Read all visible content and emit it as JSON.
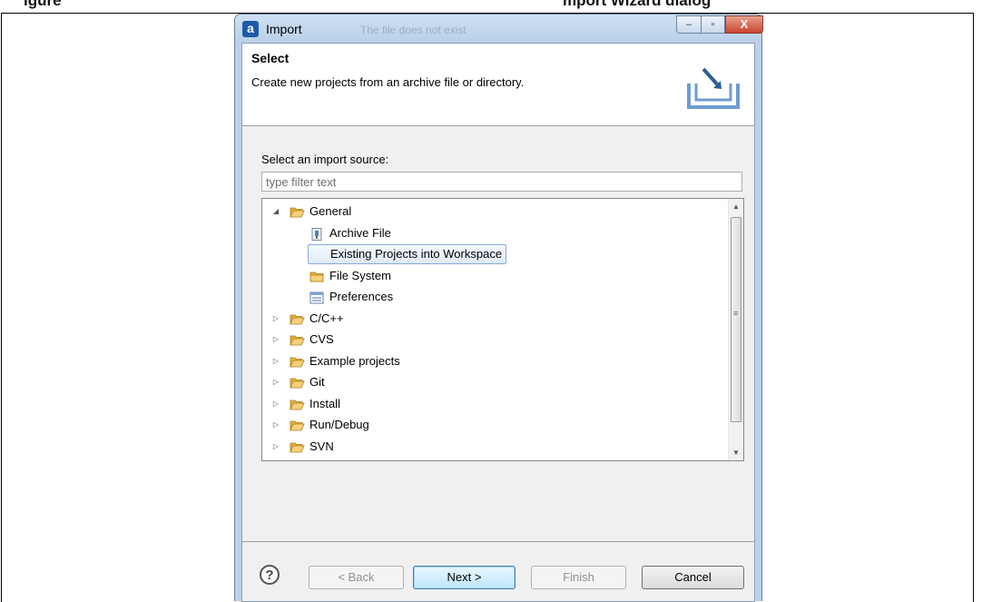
{
  "doc": {
    "top_text_left": "igure",
    "top_text_right": "mport Wizard dialog"
  },
  "window": {
    "title": "Import",
    "app_icon_letter": "a",
    "ghost_text": "The file does not exist",
    "min_glyph": "–",
    "max_glyph": "▫",
    "close_glyph": "X"
  },
  "header": {
    "title": "Select",
    "description": "Create new projects from an archive file or directory."
  },
  "source": {
    "label": "Select an import source:",
    "filter_placeholder": "type filter text",
    "filter_value": ""
  },
  "tree": {
    "items": [
      {
        "label": "General",
        "icon": "folder-open-icon",
        "expanded": true,
        "level": 0
      },
      {
        "label": "Archive File",
        "icon": "archive-file-icon",
        "level": 1
      },
      {
        "label": "Existing Projects into Workspace",
        "icon": "projects-folder-icon",
        "level": 1,
        "selected": true
      },
      {
        "label": "File System",
        "icon": "folder-icon",
        "level": 1
      },
      {
        "label": "Preferences",
        "icon": "preferences-icon",
        "level": 1
      },
      {
        "label": "C/C++",
        "icon": "folder-open-icon",
        "expanded": false,
        "level": 0
      },
      {
        "label": "CVS",
        "icon": "folder-open-icon",
        "expanded": false,
        "level": 0
      },
      {
        "label": "Example projects",
        "icon": "folder-open-icon",
        "expanded": false,
        "level": 0
      },
      {
        "label": "Git",
        "icon": "folder-open-icon",
        "expanded": false,
        "level": 0
      },
      {
        "label": "Install",
        "icon": "folder-open-icon",
        "expanded": false,
        "level": 0
      },
      {
        "label": "Run/Debug",
        "icon": "folder-open-icon",
        "expanded": false,
        "level": 0
      },
      {
        "label": "SVN",
        "icon": "folder-open-icon",
        "expanded": false,
        "level": 0
      }
    ]
  },
  "buttons": {
    "help": "?",
    "back": "< Back",
    "next": "Next >",
    "finish": "Finish",
    "cancel": "Cancel"
  },
  "colors": {
    "folder": "#e8b33a",
    "selection_border": "#84acdd",
    "title_bar": "#b9d1ea"
  }
}
